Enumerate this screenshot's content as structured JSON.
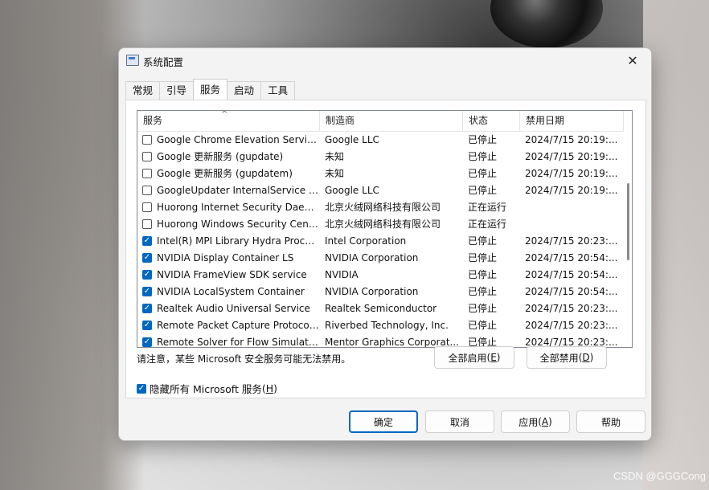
{
  "window": {
    "title": "系统配置",
    "close_glyph": "✕"
  },
  "tabs": [
    {
      "label": "常规"
    },
    {
      "label": "引导"
    },
    {
      "label": "服务",
      "active": true
    },
    {
      "label": "启动"
    },
    {
      "label": "工具"
    }
  ],
  "list": {
    "headers": [
      "服务",
      "制造商",
      "状态",
      "禁用日期"
    ],
    "rows": [
      {
        "checked": false,
        "service": "Google Chrome Elevation Servic...",
        "maker": "Google LLC",
        "status": "已停止",
        "date": "2024/7/15 20:19:..."
      },
      {
        "checked": false,
        "service": "Google 更新服务 (gupdate)",
        "maker": "未知",
        "status": "已停止",
        "date": "2024/7/15 20:19:..."
      },
      {
        "checked": false,
        "service": "Google 更新服务 (gupdatem)",
        "maker": "未知",
        "status": "已停止",
        "date": "2024/7/15 20:19:..."
      },
      {
        "checked": false,
        "service": "GoogleUpdater InternalService 1...",
        "maker": "Google LLC",
        "status": "已停止",
        "date": "2024/7/15 20:19:..."
      },
      {
        "checked": false,
        "service": "Huorong Internet Security Daem...",
        "maker": "北京火绒网络科技有限公司",
        "status": "正在运行",
        "date": ""
      },
      {
        "checked": false,
        "service": "Huorong Windows Security Center",
        "maker": "北京火绒网络科技有限公司",
        "status": "正在运行",
        "date": ""
      },
      {
        "checked": true,
        "service": "Intel(R) MPI Library Hydra Proce...",
        "maker": "Intel Corporation",
        "status": "已停止",
        "date": "2024/7/15 20:23:..."
      },
      {
        "checked": true,
        "service": "NVIDIA Display Container LS",
        "maker": "NVIDIA Corporation",
        "status": "已停止",
        "date": "2024/7/15 20:54:..."
      },
      {
        "checked": true,
        "service": "NVIDIA FrameView SDK service",
        "maker": "NVIDIA",
        "status": "已停止",
        "date": "2024/7/15 20:54:..."
      },
      {
        "checked": true,
        "service": "NVIDIA LocalSystem Container",
        "maker": "NVIDIA Corporation",
        "status": "已停止",
        "date": "2024/7/15 20:54:..."
      },
      {
        "checked": true,
        "service": "Realtek Audio Universal Service",
        "maker": "Realtek Semiconductor",
        "status": "已停止",
        "date": "2024/7/15 20:23:..."
      },
      {
        "checked": true,
        "service": "Remote Packet Capture Protocol...",
        "maker": "Riverbed Technology, Inc.",
        "status": "已停止",
        "date": "2024/7/15 20:23:..."
      },
      {
        "checked": true,
        "service": "Remote Solver for Flow Simulatio...",
        "maker": "Mentor Graphics Corporat...",
        "status": "已停止",
        "date": "2024/7/15 20:23:..."
      }
    ]
  },
  "note": "请注意，某些 Microsoft 安全服务可能无法禁用。",
  "buttons": {
    "enable_all": "全部启用",
    "enable_all_key": "E",
    "disable_all": "全部禁用",
    "disable_all_key": "D",
    "ok": "确定",
    "cancel": "取消",
    "apply": "应用",
    "apply_key": "A",
    "help": "帮助"
  },
  "hide_ms": {
    "label": "隐藏所有 Microsoft 服务",
    "key": "H",
    "checked": true
  },
  "watermark": "CSDN @GGGCong",
  "colors": {
    "accent": "#0067c0"
  }
}
